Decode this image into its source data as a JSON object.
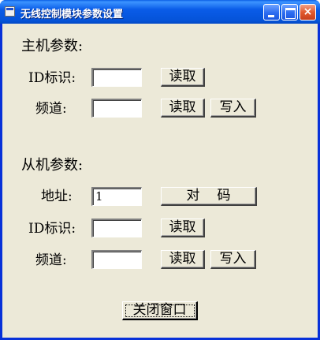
{
  "window": {
    "title": "无线控制模块参数设置"
  },
  "titlebar_buttons": {
    "minimize": "minimize-icon",
    "maximize": "maximize-icon",
    "close": "×"
  },
  "host": {
    "heading": "主机参数:",
    "id_label": "ID标识:",
    "id_value": "",
    "channel_label": "频道:",
    "channel_value": "",
    "read_label": "读取",
    "write_label": "写入"
  },
  "slave": {
    "heading": "从机参数:",
    "address_label": "地址:",
    "address_value": "1",
    "pair_label": "对码",
    "id_label": "ID标识:",
    "id_value": "",
    "channel_label": "频道:",
    "channel_value": "",
    "read_label": "读取",
    "write_label": "写入"
  },
  "close_button": "关闭窗口",
  "colors": {
    "titlebar": "#0a5ce8",
    "client_bg": "#ece9d8",
    "close_btn": "#e25a2e"
  }
}
